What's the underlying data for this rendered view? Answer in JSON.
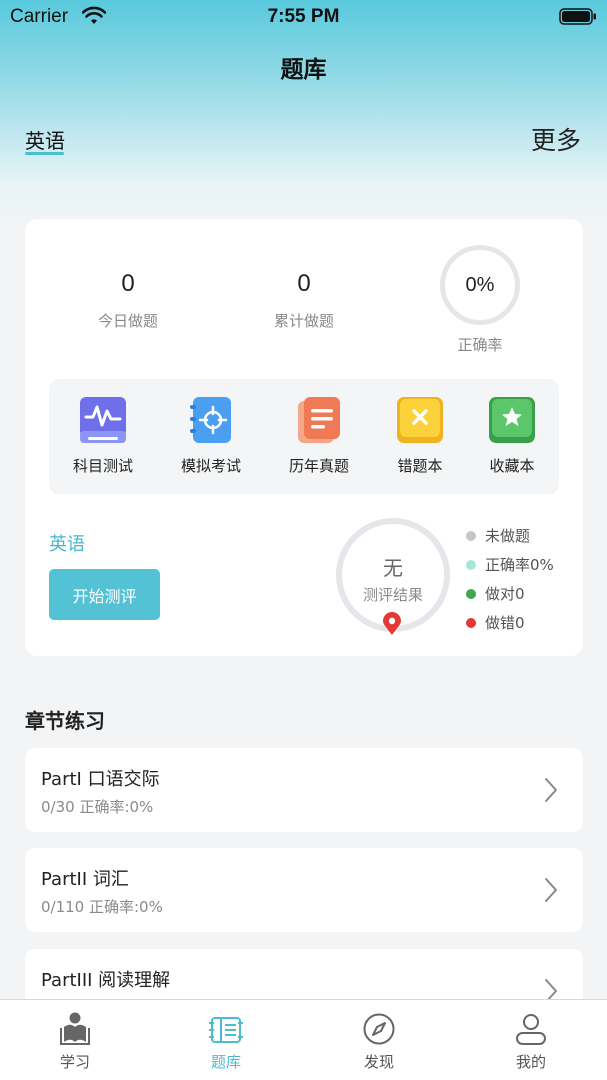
{
  "status_bar": {
    "carrier": "Carrier",
    "time": "7:55 PM"
  },
  "header": {
    "title": "题库",
    "subject_tab": "英语",
    "more": "更多"
  },
  "stats": {
    "today": {
      "value": "0",
      "label": "今日做题"
    },
    "total": {
      "value": "0",
      "label": "累计做题"
    },
    "accuracy": {
      "value": "0%",
      "label": "正确率"
    }
  },
  "tools": [
    {
      "label": "科目测试",
      "icon": "subject-test-icon"
    },
    {
      "label": "模拟考试",
      "icon": "mock-exam-icon"
    },
    {
      "label": "历年真题",
      "icon": "past-papers-icon"
    },
    {
      "label": "错题本",
      "icon": "wrong-book-icon"
    },
    {
      "label": "收藏本",
      "icon": "favorites-icon"
    }
  ],
  "evaluation": {
    "subject": "英语",
    "start_button": "开始测评",
    "ring_main": "无",
    "ring_sub": "测评结果",
    "legend": [
      {
        "label": "未做题",
        "color": "#c4c6ca"
      },
      {
        "label": "正确率0%",
        "color": "#a8e6d8"
      },
      {
        "label": "做对0",
        "color": "#3ea84a"
      },
      {
        "label": "做错0",
        "color": "#e53935"
      }
    ]
  },
  "chapters": {
    "title": "章节练习",
    "items": [
      {
        "title": "PartI 口语交际",
        "progress": "0/30 正确率:0%"
      },
      {
        "title": "PartII 词汇",
        "progress": "0/110 正确率:0%"
      },
      {
        "title": "PartIII 阅读理解",
        "progress": ""
      }
    ]
  },
  "tabbar": {
    "items": [
      {
        "label": "学习",
        "icon": "study-icon"
      },
      {
        "label": "题库",
        "icon": "question-bank-icon",
        "active": true
      },
      {
        "label": "发现",
        "icon": "discover-compass-icon"
      },
      {
        "label": "我的",
        "icon": "profile-icon"
      }
    ]
  },
  "colors": {
    "accent": "#4cbcd0",
    "button": "#53c2d5"
  }
}
